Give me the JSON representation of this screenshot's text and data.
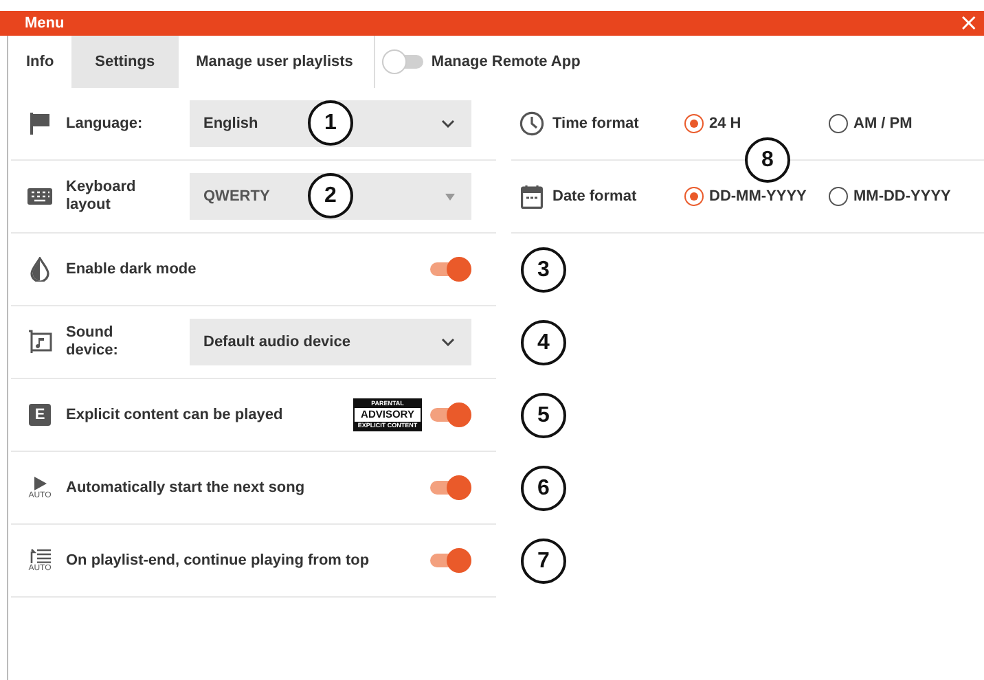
{
  "window": {
    "title": "Menu",
    "close": "×"
  },
  "tabs": [
    {
      "label": "Info",
      "selected": false
    },
    {
      "label": "Settings",
      "selected": true
    },
    {
      "label": "Manage user playlists",
      "selected": false
    }
  ],
  "remote_app": {
    "label": "Manage Remote App",
    "on": false
  },
  "settings": [
    {
      "kind": "select",
      "label": "Language:",
      "value": "English",
      "callout": "1"
    },
    {
      "kind": "select",
      "label": "Keyboard layout",
      "value": "QWERTY",
      "callout": "2"
    },
    {
      "kind": "toggle",
      "label": "Enable dark mode",
      "on": true,
      "callout": "3"
    },
    {
      "kind": "select",
      "label": "Sound device:",
      "value": "Default audio device",
      "callout": "4"
    },
    {
      "kind": "toggle",
      "icon_text": "E",
      "label": "Explicit content can be played",
      "on": true,
      "advisory": [
        "PARENTAL",
        "ADVISORY",
        "EXPLICIT CONTENT"
      ],
      "callout": "5"
    },
    {
      "kind": "toggle",
      "icon_caption": "AUTO",
      "label": "Automatically start the next song",
      "on": true,
      "callout": "6"
    },
    {
      "kind": "toggle",
      "icon_caption": "AUTO",
      "label": "On playlist-end, continue playing from top",
      "on": true,
      "callout": "7"
    }
  ],
  "formats": [
    {
      "label": "Time format",
      "options": [
        {
          "label": "24 H",
          "selected": true
        },
        {
          "label": "AM / PM",
          "selected": false
        }
      ]
    },
    {
      "label": "Date format",
      "options": [
        {
          "label": "DD-MM-YYYY",
          "selected": true
        },
        {
          "label": "MM-DD-YYYY",
          "selected": false
        }
      ]
    }
  ],
  "formats_callout": "8"
}
